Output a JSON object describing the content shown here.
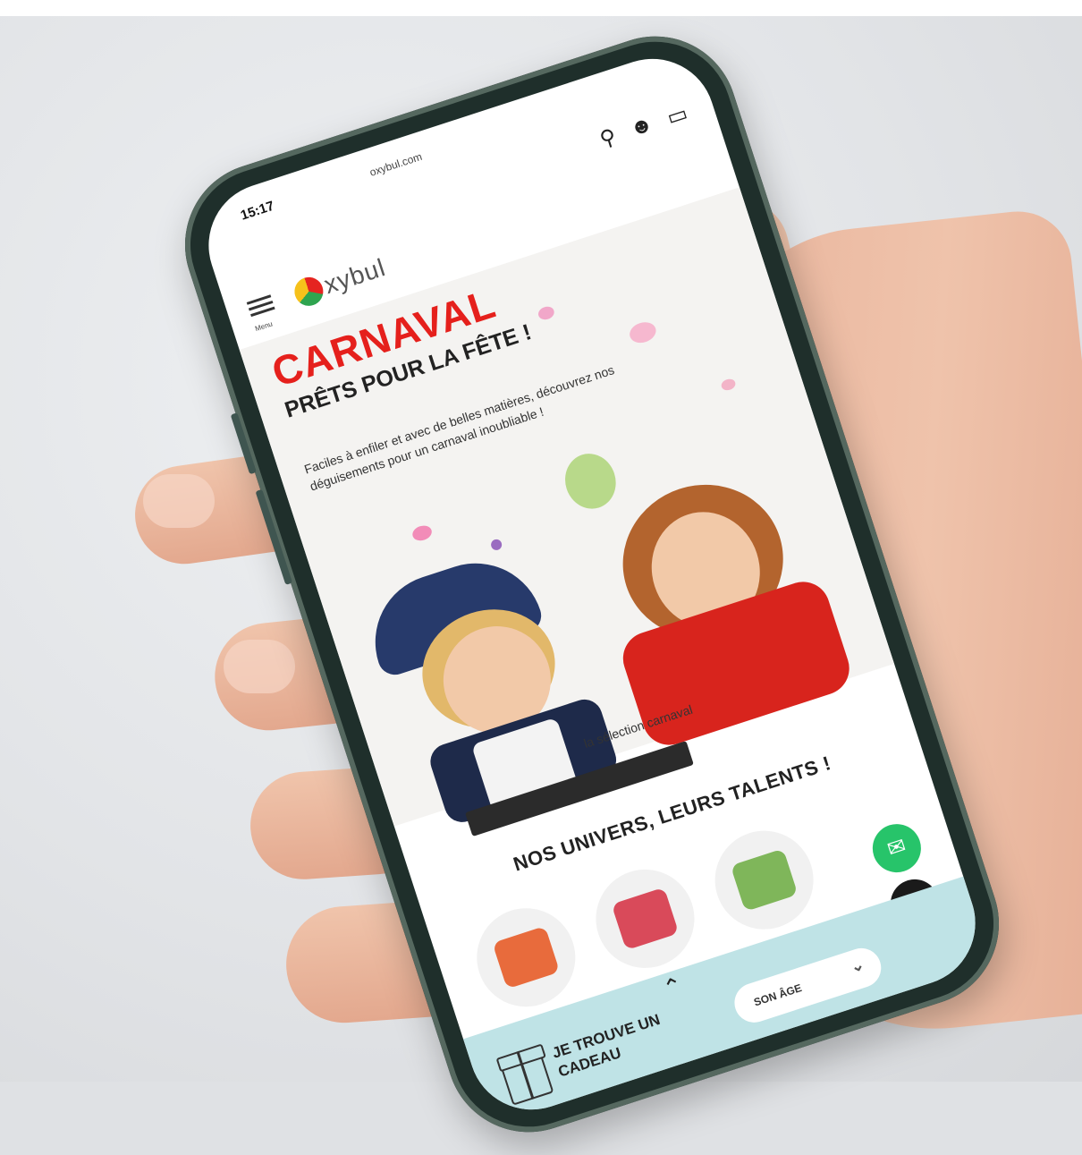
{
  "status_bar": {
    "time": "15:17",
    "url": "oxybul.com"
  },
  "header": {
    "menu_label": "Menu",
    "logo_text": "xybul",
    "icons": [
      "search-icon",
      "account-icon",
      "cart-icon"
    ]
  },
  "hero": {
    "title": "CARNAVAL",
    "subtitle": "PRÊTS POUR LA FÊTE !",
    "description": "Faciles à enfiler et avec de belles matières, découvrez nos déguisements pour un carnaval inoubliable !",
    "link": "la sélection carnaval"
  },
  "section": {
    "title": "NOS UNIVERS, LEURS TALENTS !"
  },
  "bottom_bar": {
    "cta": "JE TROUVE UN CADEAU",
    "age_selector": "SON ÂGE"
  },
  "colors": {
    "brand_red": "#e5201c",
    "bottom_bar": "#bfe3e6",
    "chat": "#27c46a",
    "phone_frame": "#1f2f2b"
  }
}
